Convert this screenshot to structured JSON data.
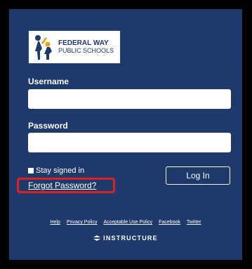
{
  "logo": {
    "line1": "FEDERAL WAY",
    "line2": "PUBLIC SCHOOLS",
    "icon": "school-figures-logo"
  },
  "login": {
    "username_label": "Username",
    "username_value": "",
    "password_label": "Password",
    "password_value": "",
    "stay_signed_in_label": "Stay signed in",
    "forgot_password_label": "Forgot Password?",
    "login_button_label": "Log In"
  },
  "footer": {
    "links": [
      "Help",
      "Privacy Policy",
      "Acceptable Use Policy",
      "Facebook",
      "Twitter"
    ],
    "brand": "INSTRUCTURE"
  },
  "colors": {
    "background": "#000000",
    "panel": "#1e3a6b",
    "highlight": "#e0201b"
  }
}
